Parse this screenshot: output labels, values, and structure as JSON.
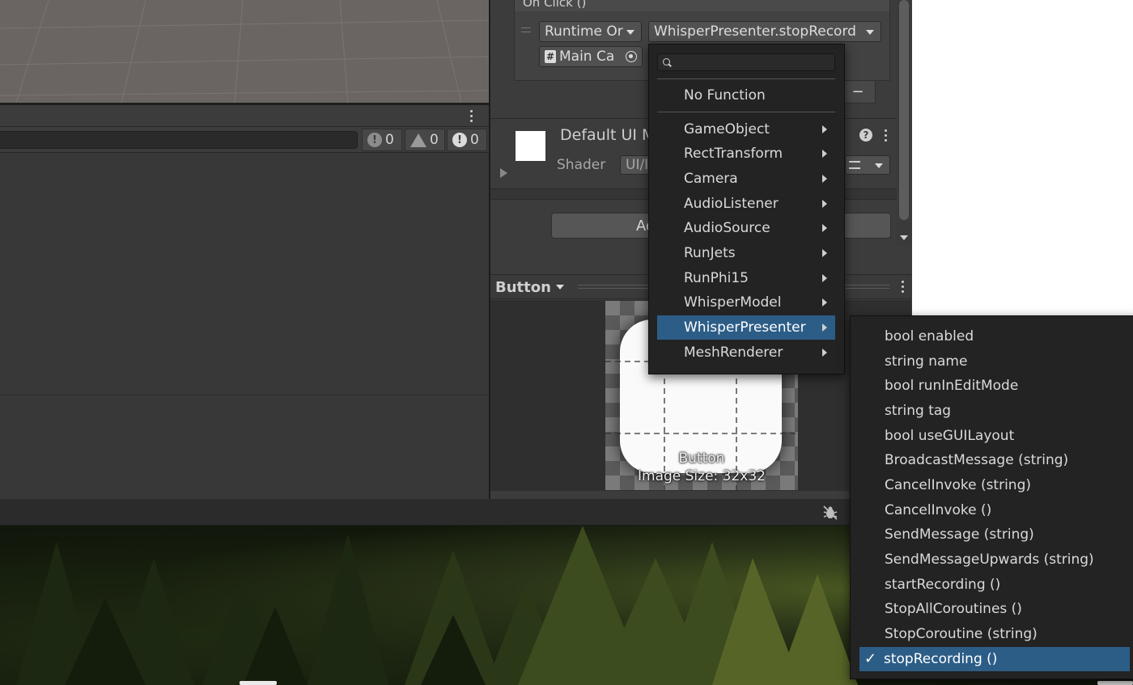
{
  "inspector": {
    "onclick_header": "On Click ()",
    "runtime_dropdown": "Runtime Or",
    "function_dropdown": "WhisperPresenter.stopRecord",
    "target_object": "Main Ca",
    "minus_label": "−",
    "material_name": "Default UI M",
    "shader_label": "Shader",
    "shader_value": "UI/I",
    "add_component_label": "Ad",
    "preview_title": "Button",
    "preview_caption": "Button",
    "preview_size": "Image Size: 32x32"
  },
  "console": {
    "info_count": "0",
    "warning_count": "0",
    "error_count": "0"
  },
  "menu_primary": {
    "search_placeholder": "",
    "none_item": "No Function",
    "items": [
      {
        "label": "GameObject"
      },
      {
        "label": "RectTransform"
      },
      {
        "label": "Camera"
      },
      {
        "label": "AudioListener"
      },
      {
        "label": "AudioSource"
      },
      {
        "label": "RunJets"
      },
      {
        "label": "RunPhi15"
      },
      {
        "label": "WhisperModel"
      },
      {
        "label": "WhisperPresenter"
      },
      {
        "label": "MeshRenderer"
      }
    ],
    "selected_index": 8
  },
  "menu_submenu": {
    "items": [
      {
        "label": "bool enabled"
      },
      {
        "label": "string name"
      },
      {
        "label": "bool runInEditMode"
      },
      {
        "label": "string tag"
      },
      {
        "label": "bool useGUILayout"
      },
      {
        "label": "BroadcastMessage (string)"
      },
      {
        "label": "CancelInvoke (string)"
      },
      {
        "label": "CancelInvoke ()"
      },
      {
        "label": "SendMessage (string)"
      },
      {
        "label": "SendMessageUpwards (string)"
      },
      {
        "label": "startRecording ()"
      },
      {
        "label": "StopAllCoroutines ()"
      },
      {
        "label": "StopCoroutine (string)"
      },
      {
        "label": "stopRecording ()"
      }
    ],
    "checkmark": "✓",
    "selected_index": 13
  },
  "colors": {
    "selection": "#2c5d87",
    "menu_bg": "#232323",
    "panel_bg": "#3c3c3c"
  }
}
